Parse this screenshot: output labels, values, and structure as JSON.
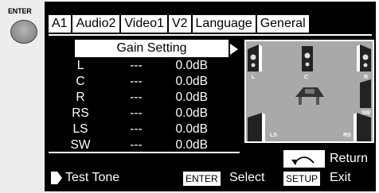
{
  "remote": {
    "enter_label": "ENTER",
    "enter_button_icon": "round-enter-button"
  },
  "tabs": [
    {
      "label": "A1",
      "active": false
    },
    {
      "label": "Audio2",
      "active": true
    },
    {
      "label": "Video1",
      "active": false
    },
    {
      "label": "V2",
      "active": false
    },
    {
      "label": "Language",
      "active": false
    },
    {
      "label": "General",
      "active": false
    }
  ],
  "gain": {
    "title": "Gain Setting",
    "rows": [
      {
        "channel": "L",
        "dash": "---",
        "value": "0.0dB"
      },
      {
        "channel": "C",
        "dash": "---",
        "value": "0.0dB"
      },
      {
        "channel": "R",
        "dash": "---",
        "value": "0.0dB"
      },
      {
        "channel": "RS",
        "dash": "---",
        "value": "0.0dB"
      },
      {
        "channel": "LS",
        "dash": "---",
        "value": "0.0dB"
      },
      {
        "channel": "SW",
        "dash": "---",
        "value": "0.0dB"
      }
    ]
  },
  "diagram": {
    "labels": {
      "l": "L",
      "c": "C",
      "r": "R",
      "sw": "SW",
      "ls": "LS",
      "rs": "RS"
    }
  },
  "footer": {
    "test_tone": "Test Tone",
    "enter_key": "ENTER",
    "select": "Select",
    "return_icon": "return-arrow-icon",
    "return": "Return",
    "setup_key": "SETUP",
    "exit": "Exit"
  },
  "colors": {
    "screen_bg": "#000000",
    "diagram_bg": "#a9a9a9",
    "remote_bg": "#ededed"
  }
}
